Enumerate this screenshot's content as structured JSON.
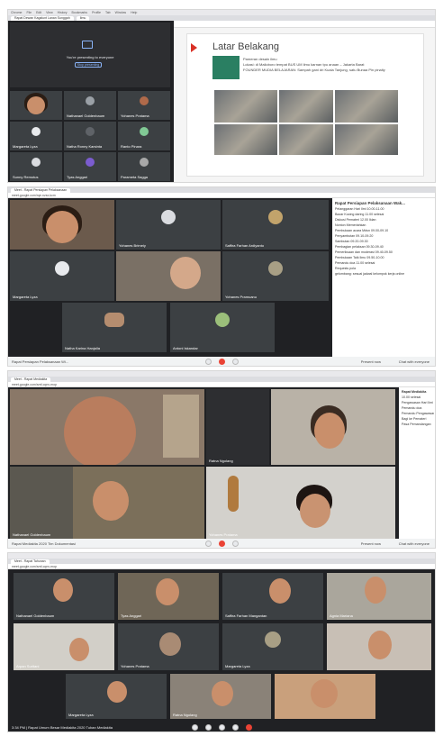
{
  "panel1": {
    "menu": [
      "Chrome",
      "File",
      "Edit",
      "View",
      "History",
      "Bookmarks",
      "Profile",
      "Tab",
      "Window",
      "Help"
    ],
    "presenting_text": "You're presenting to everyone",
    "stop_label": "Stop presenting",
    "tiles": [
      {
        "name": ""
      },
      {
        "name": "Nathanael Goldenbaum"
      },
      {
        "name": "Yohanes Pratama"
      },
      {
        "name": "Margareta Lyza"
      },
      {
        "name": "Natha Ronny Karsinta"
      },
      {
        "name": "Ranto Pinara"
      },
      {
        "name": "Sunny Remotus"
      },
      {
        "name": "Tyas Anggari"
      },
      {
        "name": "Parameta Sagga"
      }
    ],
    "slide": {
      "title": "Latar Belakang",
      "bullets": [
        "Pameran desain ilmu",
        "Lokasi: di Malioboro tempat BUS UM ilmu karnan tpu anaan – Jakarta Barat",
        "FOUNDER MUDIA BELAJARAN: Sampah gani dri Kuala Tanjung, satu Bunaa Pin pinalty"
      ]
    },
    "tab": "Rapat Dewan Kagalunt Lanan Sunggah",
    "extra_tab": "Ilmu"
  },
  "panel2": {
    "tab": "Meet - Rapat Persiapan Pelaksanaan",
    "url": "meet.google.com/rqe-nzsx-kcm",
    "tiles": [
      {
        "name": ""
      },
      {
        "name": "Yohanes Brimeiy"
      },
      {
        "name": "Saffira Farhan Ardiyanto"
      },
      {
        "name": "Margareta Lyza"
      },
      {
        "name": ""
      },
      {
        "name": "Yohanes Pramuanu"
      },
      {
        "name": "Natha Karina Hanjalla"
      },
      {
        "name": "Antoni Iskandar"
      }
    ],
    "side_title": "Rapat Persiapan Pelaksanaan Wak...",
    "side_lines": [
      "Pelanggaran Hari Ilmi      10.00-11.00",
      "Bazar Kucing daring        11.00 selesai",
      "Diskusi Pemateri  12.00 Iklan",
      "Nonton Memeriahkan",
      "Pembukaan acara Mdsn    09.00-09.10",
      "Penyambutan               09.10-09.20",
      "Sambutan                  09.20-09.30",
      "Pembagian pelaksan      09.30-09.40",
      "Pemeriksaan dan moderasi 09.40-09.50",
      "Pembukaan Talk Ilmu      09.50-10.00",
      "Pemandu doa              11.00 selesai",
      "Requests pola",
      "gelombang: sesuai jadwal kelompok kerja online"
    ],
    "meeting_title": "Rapat Persiapan Pelaksanaan Wi...",
    "present_label": "Present now",
    "chat_label": "Chat with everyone"
  },
  "panel3": {
    "url": "meet.google.com/smf-cqnv-mop",
    "tab": "Meet - Rapat Mediakita",
    "tiles": [
      {
        "name": ""
      },
      {
        "name": "Ratna Ngolang"
      },
      {
        "name": ""
      },
      {
        "name": "Nathanael Goldenbaum"
      },
      {
        "name": ""
      },
      {
        "name": "Yohanes Pratama"
      }
    ],
    "side_title": "Rapat Mediakita",
    "side_lines": [
      "10.00 selesai",
      "Pengawasan Hari Ilmi",
      "Pemandu doa",
      "Pemandu Pengawasan",
      "Bagi ke Pemateri",
      "Pasa Pemandangan"
    ],
    "meeting_title": "Rapat Mediakita 2020 Tim Dokumentasi",
    "present_label": "Present now",
    "chat_label": "Chat with everyone"
  },
  "panel4": {
    "url": "meet.google.com/smf-cqnv-mop",
    "tab": "Meet - Rapat Tahunan",
    "tiles": [
      {
        "name": "Nathanael Goldenbaum"
      },
      {
        "name": "Tyas Anggari"
      },
      {
        "name": "Saffira Farhan Mangantan"
      },
      {
        "name": "Agnia Mariana"
      },
      {
        "name": "Arpan Suritani"
      },
      {
        "name": "Yohanes Pratama"
      },
      {
        "name": "Margareta Lyza"
      },
      {
        "name": ""
      },
      {
        "name": "Margareta Lyza"
      },
      {
        "name": "Ratna Ngolang"
      },
      {
        "name": ""
      }
    ],
    "footer": "3:34 PM | Rapat Umum Besar Mediakita 2020 Tuban Mediakita"
  }
}
